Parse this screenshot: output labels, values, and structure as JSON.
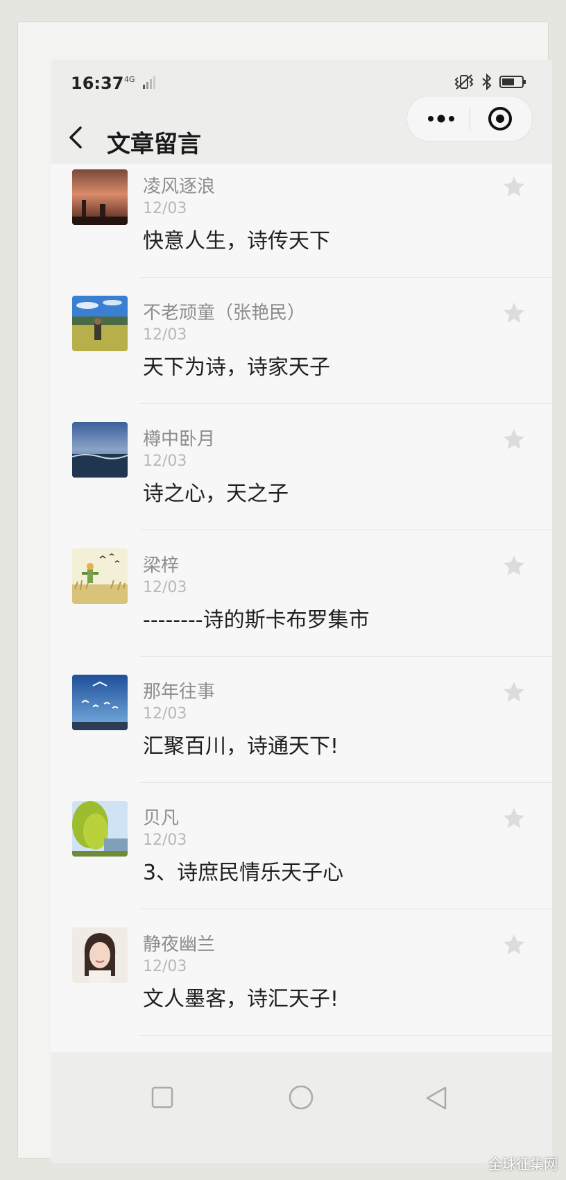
{
  "status_bar": {
    "time": "16:37",
    "network": "4G"
  },
  "nav": {
    "title": "文章留言"
  },
  "comments": [
    {
      "name": "凌风逐浪",
      "date": "12/03",
      "text": "快意人生，诗传天下"
    },
    {
      "name": "不老顽童（张艳民）",
      "date": "12/03",
      "text": "天下为诗，诗家天子"
    },
    {
      "name": "樽中卧月",
      "date": "12/03",
      "text": "诗之心，天之子"
    },
    {
      "name": "梁梓",
      "date": "12/03",
      "text": "--------诗的斯卡布罗集市"
    },
    {
      "name": "那年往事",
      "date": "12/03",
      "text": "汇聚百川，诗通天下!"
    },
    {
      "name": "贝凡",
      "date": "12/03",
      "text": "3、诗庶民情乐天子心"
    },
    {
      "name": "静夜幽兰",
      "date": "12/03",
      "text": "文人墨客，诗汇天子!"
    }
  ],
  "watermark": "全球征集网",
  "colors": {
    "name_gray": "#8d8d8d",
    "date_gray": "#b8b8b8",
    "text_dark": "#1f1f1f",
    "star_gray": "#dcdcdc"
  }
}
